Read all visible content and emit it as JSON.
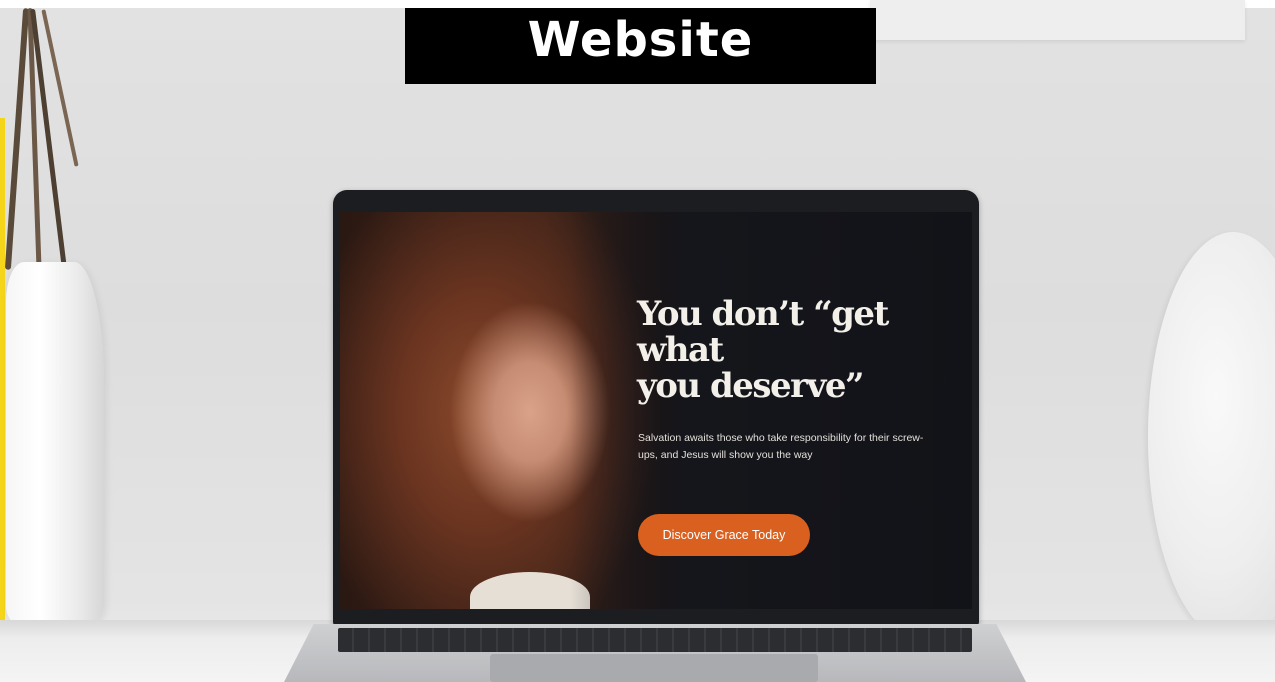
{
  "banner": {
    "title": "Website"
  },
  "hero": {
    "heading_line1": "You don’t “get what",
    "heading_line2": "you deserve”",
    "subtext": "Salvation awaits those who take responsibility for their screw-ups, and Jesus will show you the way",
    "cta_label": "Discover Grace Today"
  },
  "colors": {
    "banner_bg": "#000000",
    "accent_strip": "#f4d51a",
    "cta_orange": "#d9601f",
    "screen_bg": "#15161b"
  }
}
